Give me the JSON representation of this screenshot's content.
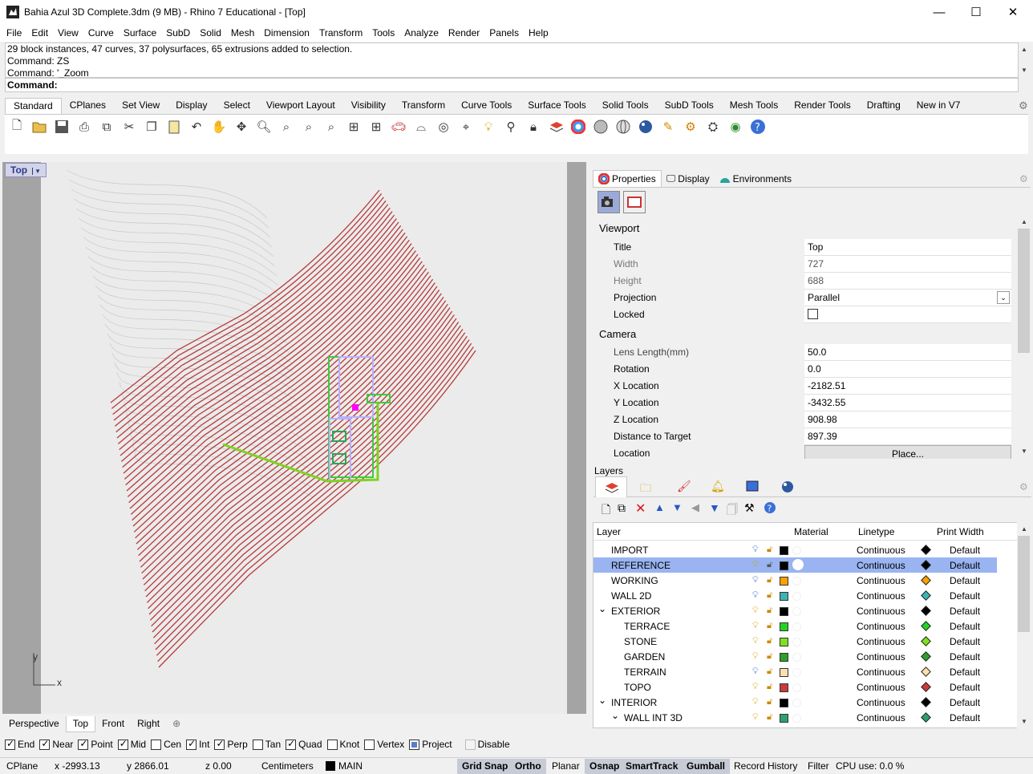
{
  "window": {
    "title": "Bahia Azul 3D Complete.3dm (9 MB) - Rhino 7 Educational - [Top]",
    "minimize": "—",
    "maximize": "☐",
    "close": "✕"
  },
  "menu": [
    "File",
    "Edit",
    "View",
    "Curve",
    "Surface",
    "SubD",
    "Solid",
    "Mesh",
    "Dimension",
    "Transform",
    "Tools",
    "Analyze",
    "Render",
    "Panels",
    "Help"
  ],
  "command": {
    "history": [
      "29 block instances, 47 curves, 37 polysurfaces, 65 extrusions added to selection.",
      "Command: ZS",
      "Command: '_Zoom"
    ],
    "prompt": "Command:"
  },
  "toolbar_tabs": [
    "Standard",
    "CPlanes",
    "Set View",
    "Display",
    "Select",
    "Viewport Layout",
    "Visibility",
    "Transform",
    "Curve Tools",
    "Surface Tools",
    "Solid Tools",
    "SubD Tools",
    "Mesh Tools",
    "Render Tools",
    "Drafting",
    "New in V7"
  ],
  "toolbar_icons": [
    "new-icon",
    "open-icon",
    "save-icon",
    "print-icon",
    "import-icon",
    "cut-icon",
    "copy-icon",
    "paste-icon",
    "undo-icon",
    "pan-icon",
    "rotate-view-icon",
    "zoom-icon",
    "zoom-window-icon",
    "zoom-extents-icon",
    "zoom-selected-icon",
    "viewport-layout-icon",
    "car-icon",
    "plane-icon",
    "circle-plane-icon",
    "point-icon",
    "bulb-icon",
    "light-icon",
    "lock-icon",
    "layer-icon",
    "color-wheel-icon",
    "material-sphere-icon",
    "wire-sphere-icon",
    "shaded-sphere-icon",
    "render-sphere-icon",
    "pen-icon",
    "gear-icon",
    "options-icon",
    "globe-icon",
    "help-icon"
  ],
  "viewport": {
    "label": "Top",
    "axis_x": "x",
    "axis_y": "y"
  },
  "view_tabs": [
    "Perspective",
    "Top",
    "Front",
    "Right"
  ],
  "view_tabs_add": "⊕",
  "osnap": [
    {
      "label": "End",
      "checked": true
    },
    {
      "label": "Near",
      "checked": true
    },
    {
      "label": "Point",
      "checked": true
    },
    {
      "label": "Mid",
      "checked": true
    },
    {
      "label": "Cen",
      "checked": false
    },
    {
      "label": "Int",
      "checked": true
    },
    {
      "label": "Perp",
      "checked": true
    },
    {
      "label": "Tan",
      "checked": false
    },
    {
      "label": "Quad",
      "checked": true
    },
    {
      "label": "Knot",
      "checked": false
    },
    {
      "label": "Vertex",
      "checked": false
    },
    {
      "label": "Project",
      "checked": "partial"
    },
    {
      "label": "Disable",
      "checked": false
    }
  ],
  "status": {
    "cplane": "CPlane",
    "x": "x -2993.13",
    "y": "y 2866.01",
    "z": "z 0.00",
    "units": "Centimeters",
    "layer": "MAIN",
    "panes": [
      {
        "label": "Grid Snap",
        "on": true
      },
      {
        "label": "Ortho",
        "on": true
      },
      {
        "label": "Planar",
        "on": false
      },
      {
        "label": "Osnap",
        "on": true
      },
      {
        "label": "SmartTrack",
        "on": true
      },
      {
        "label": "Gumball",
        "on": true
      },
      {
        "label": "Record History",
        "on": false
      },
      {
        "label": "Filter",
        "on": false
      }
    ],
    "cpu": "CPU use: 0.0 %"
  },
  "properties": {
    "tabs": [
      "Properties",
      "Display",
      "Environments"
    ],
    "sections": {
      "viewport": "Viewport",
      "camera": "Camera"
    },
    "viewport_rows": [
      {
        "label": "Title",
        "value": "Top"
      },
      {
        "label": "Width",
        "value": "727"
      },
      {
        "label": "Height",
        "value": "688"
      },
      {
        "label": "Projection",
        "value": "Parallel"
      },
      {
        "label": "Locked",
        "value": ""
      }
    ],
    "camera_rows": [
      {
        "label": "Lens Length(mm)",
        "value": "50.0"
      },
      {
        "label": "Rotation",
        "value": "0.0"
      },
      {
        "label": "X Location",
        "value": "-2182.51"
      },
      {
        "label": "Y Location",
        "value": "-3432.55"
      },
      {
        "label": "Z Location",
        "value": "908.98"
      },
      {
        "label": "Distance to Target",
        "value": "897.39"
      },
      {
        "label": "Location",
        "value": "Place..."
      }
    ]
  },
  "layers": {
    "title": "Layers",
    "columns": {
      "layer": "Layer",
      "material": "Material",
      "linetype": "Linetype",
      "print_width": "Print Width"
    },
    "rows": [
      {
        "name": "IMPORT",
        "indent": 0,
        "expander": "",
        "color": "#000000",
        "linetype": "Continuous",
        "pw": "Default",
        "bulb": "blue",
        "selected": false
      },
      {
        "name": "REFERENCE",
        "indent": 0,
        "expander": "",
        "color": "#000000",
        "linetype": "Continuous",
        "pw": "Default",
        "bulb": "yellow",
        "selected": true
      },
      {
        "name": "WORKING",
        "indent": 0,
        "expander": "",
        "color": "#ffa000",
        "linetype": "Continuous",
        "pw": "Default",
        "bulb": "blue",
        "selected": false
      },
      {
        "name": "WALL 2D",
        "indent": 0,
        "expander": "",
        "color": "#3cb4b4",
        "linetype": "Continuous",
        "pw": "Default",
        "bulb": "blue",
        "selected": false
      },
      {
        "name": "EXTERIOR",
        "indent": 0,
        "expander": "⌄",
        "color": "#000000",
        "linetype": "Continuous",
        "pw": "Default",
        "bulb": "yellow",
        "selected": false
      },
      {
        "name": "TERRACE",
        "indent": 1,
        "expander": "",
        "color": "#22d422",
        "linetype": "Continuous",
        "pw": "Default",
        "bulb": "yellow",
        "selected": false
      },
      {
        "name": "STONE",
        "indent": 1,
        "expander": "",
        "color": "#80e020",
        "linetype": "Continuous",
        "pw": "Default",
        "bulb": "yellow",
        "selected": false
      },
      {
        "name": "GARDEN",
        "indent": 1,
        "expander": "",
        "color": "#2ea02e",
        "linetype": "Continuous",
        "pw": "Default",
        "bulb": "yellow",
        "selected": false
      },
      {
        "name": "TERRAIN",
        "indent": 1,
        "expander": "",
        "color": "#fde0b0",
        "linetype": "Continuous",
        "pw": "Default",
        "bulb": "blue",
        "selected": false
      },
      {
        "name": "TOPO",
        "indent": 1,
        "expander": "",
        "color": "#c83c3c",
        "linetype": "Continuous",
        "pw": "Default",
        "bulb": "yellow",
        "selected": false
      },
      {
        "name": "INTERIOR",
        "indent": 0,
        "expander": "⌄",
        "color": "#000000",
        "linetype": "Continuous",
        "pw": "Default",
        "bulb": "yellow",
        "selected": false
      },
      {
        "name": "WALL INT 3D",
        "indent": 1,
        "expander": "⌄",
        "color": "#2ea070",
        "linetype": "Continuous",
        "pw": "Default",
        "bulb": "yellow",
        "selected": false
      }
    ]
  },
  "colors": {
    "topo_red": "#b83a3a",
    "selection_blue": "#99b4f0",
    "building_lavender": "#b8b0ff",
    "building_green": "#3ccc3c"
  }
}
